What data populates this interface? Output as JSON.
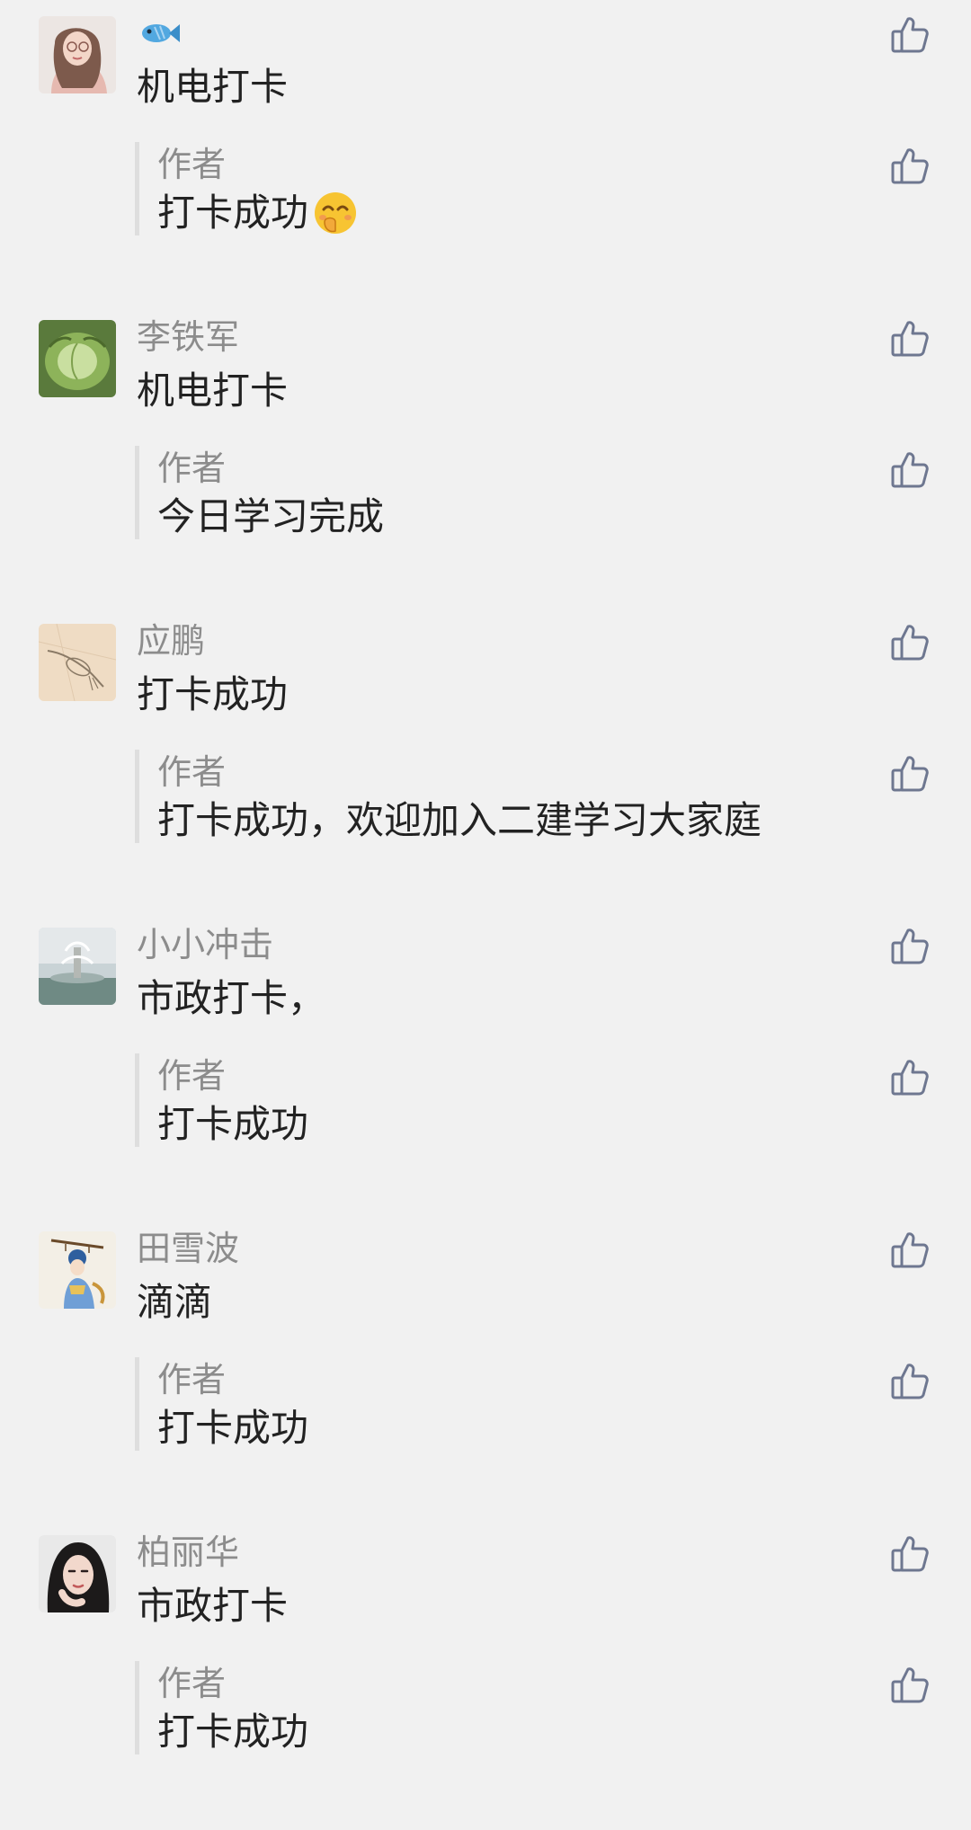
{
  "comments": [
    {
      "nickname": "",
      "nickname_icon": "fish-emoji-icon",
      "text": "机电打卡",
      "avatar": "portrait-woman-pink",
      "reply": {
        "author": "作者",
        "text": "打卡成功",
        "emoji": "giggle-face-emoji-icon"
      }
    },
    {
      "nickname": "李铁军",
      "text": "机电打卡",
      "avatar": "cabbage-photo",
      "reply": {
        "author": "作者",
        "text": "今日学习完成"
      }
    },
    {
      "nickname": "应鹏",
      "text": "打卡成功",
      "avatar": "bird-sketch",
      "reply": {
        "author": "作者",
        "text": "打卡成功，欢迎加入二建学习大家庭"
      }
    },
    {
      "nickname": "小小冲击",
      "text": "市政打卡，",
      "avatar": "fountain-photo",
      "reply": {
        "author": "作者",
        "text": "打卡成功"
      }
    },
    {
      "nickname": "田雪波",
      "text": "滴滴",
      "avatar": "illustrated-girl",
      "reply": {
        "author": "作者",
        "text": "打卡成功"
      }
    },
    {
      "nickname": "柏丽华",
      "text": "市政打卡",
      "avatar": "portrait-woman-dark",
      "reply": {
        "author": "作者",
        "text": "打卡成功"
      }
    }
  ],
  "icons": {
    "like": "thumbs-up-outline-icon"
  },
  "colors": {
    "background": "#f1f1f1",
    "nickname": "#8c8c8c",
    "text": "#222222",
    "like_icon": "#6e7790",
    "reply_bar": "#dedede"
  }
}
